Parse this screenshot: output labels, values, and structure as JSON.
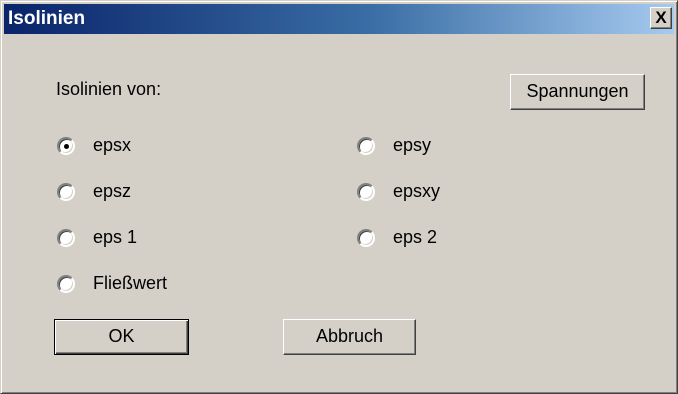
{
  "window": {
    "title": "Isolinien",
    "close_label": "X"
  },
  "form": {
    "heading": "Isolinien von:",
    "spannungen_label": "Spannungen",
    "options": [
      {
        "label": "epsx",
        "checked": true
      },
      {
        "label": "epsy",
        "checked": false
      },
      {
        "label": "epsz",
        "checked": false
      },
      {
        "label": "epsxy",
        "checked": false
      },
      {
        "label": "eps 1",
        "checked": false
      },
      {
        "label": "eps 2",
        "checked": false
      },
      {
        "label": "Fließwert",
        "checked": false
      }
    ]
  },
  "buttons": {
    "ok_label": "OK",
    "cancel_label": "Abbruch"
  }
}
